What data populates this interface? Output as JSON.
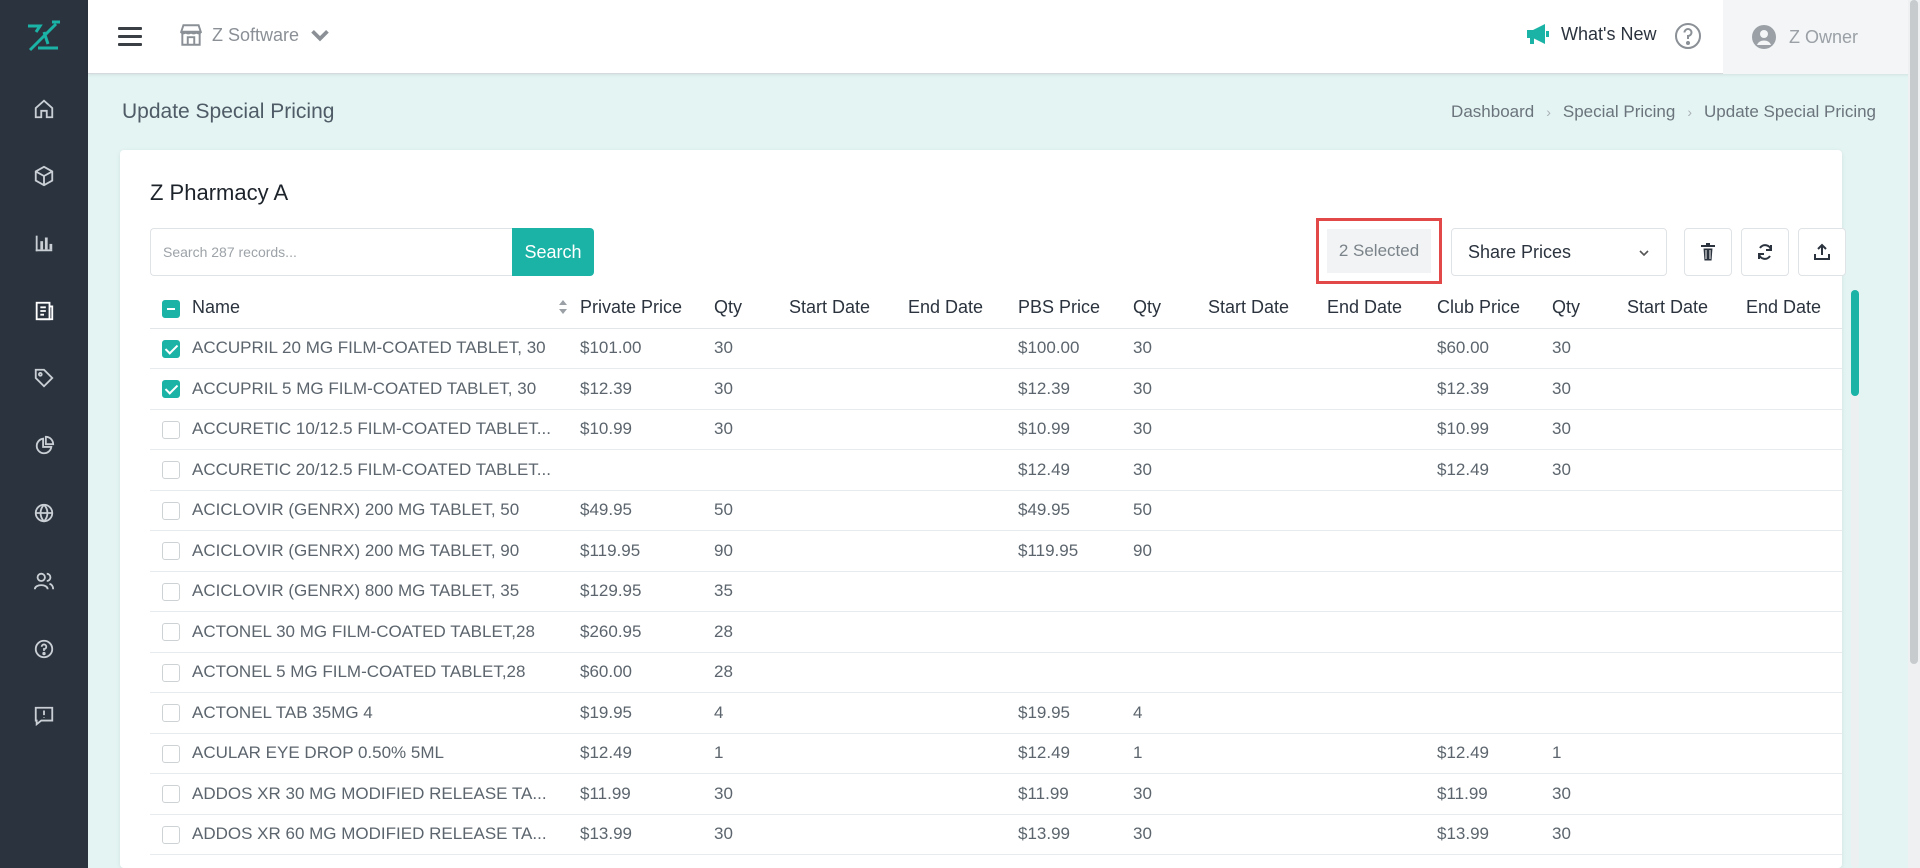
{
  "colors": {
    "accent": "#1ab3a6",
    "sidebar": "#2b333e",
    "highlight": "#e24848"
  },
  "sidebar": {
    "icons": [
      "home-icon",
      "box-icon",
      "bar-chart-icon",
      "report-icon",
      "tag-icon",
      "pie-chart-icon",
      "globe-icon",
      "users-icon",
      "help-icon",
      "feedback-icon"
    ]
  },
  "topbar": {
    "store_name": "Z Software",
    "whats_new": "What's New",
    "user_name": "Z Owner"
  },
  "page": {
    "title": "Update Special Pricing",
    "breadcrumb": [
      "Dashboard",
      "Special Pricing",
      "Update Special Pricing"
    ]
  },
  "card": {
    "title": "Z Pharmacy A",
    "search_placeholder": "Search 287 records...",
    "search_label": "Search",
    "selected_label": "2 Selected",
    "share_select_value": "Share Prices"
  },
  "table": {
    "columns": [
      "Name",
      "Private Price",
      "Qty",
      "Start Date",
      "End Date",
      "PBS Price",
      "Qty",
      "Start Date",
      "End Date",
      "Club Price",
      "Qty",
      "Start Date",
      "End Date"
    ],
    "rows": [
      {
        "checked": true,
        "cells": [
          "ACCUPRIL 20 MG FILM-COATED TABLET, 30",
          "$101.00",
          "30",
          "",
          "",
          "$100.00",
          "30",
          "",
          "",
          "$60.00",
          "30",
          "",
          ""
        ]
      },
      {
        "checked": true,
        "cells": [
          "ACCUPRIL 5 MG FILM-COATED TABLET, 30",
          "$12.39",
          "30",
          "",
          "",
          "$12.39",
          "30",
          "",
          "",
          "$12.39",
          "30",
          "",
          ""
        ]
      },
      {
        "checked": false,
        "cells": [
          "ACCURETIC 10/12.5 FILM-COATED TABLET...",
          "$10.99",
          "30",
          "",
          "",
          "$10.99",
          "30",
          "",
          "",
          "$10.99",
          "30",
          "",
          ""
        ]
      },
      {
        "checked": false,
        "cells": [
          "ACCURETIC 20/12.5 FILM-COATED TABLET...",
          "",
          "",
          "",
          "",
          "$12.49",
          "30",
          "",
          "",
          "$12.49",
          "30",
          "",
          ""
        ]
      },
      {
        "checked": false,
        "cells": [
          "ACICLOVIR (GENRX) 200 MG TABLET, 50",
          "$49.95",
          "50",
          "",
          "",
          "$49.95",
          "50",
          "",
          "",
          "",
          "",
          "",
          ""
        ]
      },
      {
        "checked": false,
        "cells": [
          "ACICLOVIR (GENRX) 200 MG TABLET, 90",
          "$119.95",
          "90",
          "",
          "",
          "$119.95",
          "90",
          "",
          "",
          "",
          "",
          "",
          ""
        ]
      },
      {
        "checked": false,
        "cells": [
          "ACICLOVIR (GENRX) 800 MG TABLET, 35",
          "$129.95",
          "35",
          "",
          "",
          "",
          "",
          "",
          "",
          "",
          "",
          "",
          ""
        ]
      },
      {
        "checked": false,
        "cells": [
          "ACTONEL 30 MG FILM-COATED TABLET,28",
          "$260.95",
          "28",
          "",
          "",
          "",
          "",
          "",
          "",
          "",
          "",
          "",
          ""
        ]
      },
      {
        "checked": false,
        "cells": [
          "ACTONEL 5 MG FILM-COATED TABLET,28",
          "$60.00",
          "28",
          "",
          "",
          "",
          "",
          "",
          "",
          "",
          "",
          "",
          ""
        ]
      },
      {
        "checked": false,
        "cells": [
          "ACTONEL TAB 35MG 4",
          "$19.95",
          "4",
          "",
          "",
          "$19.95",
          "4",
          "",
          "",
          "",
          "",
          "",
          ""
        ]
      },
      {
        "checked": false,
        "cells": [
          "ACULAR EYE DROP 0.50% 5ML",
          "$12.49",
          "1",
          "",
          "",
          "$12.49",
          "1",
          "",
          "",
          "$12.49",
          "1",
          "",
          ""
        ]
      },
      {
        "checked": false,
        "cells": [
          "ADDOS XR 30 MG MODIFIED RELEASE TA...",
          "$11.99",
          "30",
          "",
          "",
          "$11.99",
          "30",
          "",
          "",
          "$11.99",
          "30",
          "",
          ""
        ]
      },
      {
        "checked": false,
        "cells": [
          "ADDOS XR 60 MG MODIFIED RELEASE TA...",
          "$13.99",
          "30",
          "",
          "",
          "$13.99",
          "30",
          "",
          "",
          "$13.99",
          "30",
          "",
          ""
        ]
      }
    ]
  }
}
